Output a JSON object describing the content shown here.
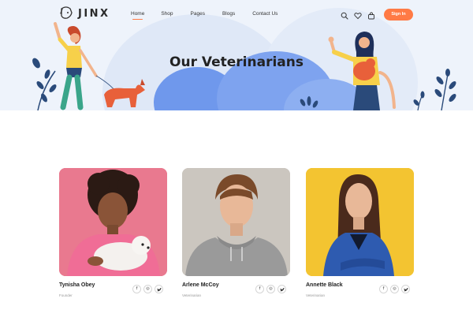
{
  "brand": {
    "name": "JINX"
  },
  "nav": {
    "links": [
      {
        "label": "Home",
        "active": true
      },
      {
        "label": "Shop"
      },
      {
        "label": "Pages"
      },
      {
        "label": "Blogs"
      },
      {
        "label": "Contact Us"
      }
    ],
    "icons": [
      "search-icon",
      "heart-icon",
      "bag-icon"
    ],
    "signin_label": "Sign In"
  },
  "hero": {
    "title": "Our Veterinarians"
  },
  "team": [
    {
      "name": "Tynisha Obey",
      "role": "Founder",
      "photo_bg": "#e8788e"
    },
    {
      "name": "Arlene McCoy",
      "role": "Veterinarian",
      "photo_bg": "#c9c4bd"
    },
    {
      "name": "Annette Black",
      "role": "Veterinarian",
      "photo_bg": "#f2c230"
    }
  ],
  "social_icons": {
    "facebook": "f",
    "instagram": "◎",
    "twitter": "🐦"
  },
  "colors": {
    "accent": "#ff7a45",
    "hero_bg": "#eef3fb",
    "hero_blue": "#6f98ec"
  }
}
